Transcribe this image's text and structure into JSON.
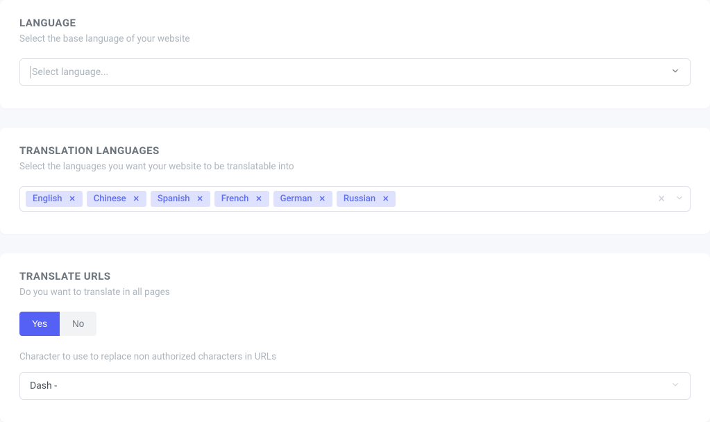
{
  "language": {
    "title": "LANGUAGE",
    "desc": "Select the base language of your website",
    "placeholder": "Select language..."
  },
  "translation": {
    "title": "TRANSLATION LANGUAGES",
    "desc": "Select the languages you want your website to be translatable into",
    "chips": [
      "English",
      "Chinese",
      "Spanish",
      "French",
      "German",
      "Russian"
    ]
  },
  "urls": {
    "title": "TRANSLATE URLS",
    "q1": "Do you want to translate in all pages",
    "yes": "Yes",
    "no": "No",
    "q2": "Character to use to replace non authorized characters in URLs",
    "char_value": "Dash -"
  }
}
